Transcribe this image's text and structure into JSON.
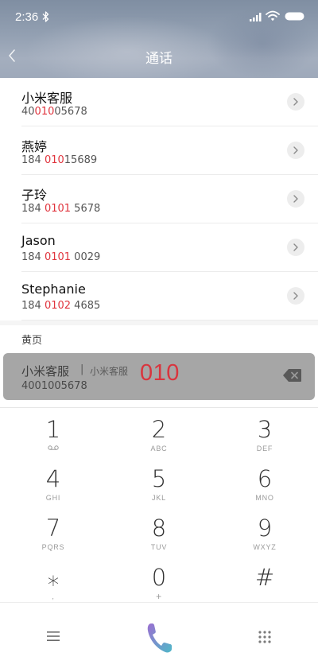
{
  "status_bar": {
    "time": "2:36",
    "icons": [
      "bluetooth-icon",
      "signal-icon",
      "wifi-icon",
      "battery-icon"
    ]
  },
  "header": {
    "title": "通话",
    "back_icon": "chevron-left-icon"
  },
  "contacts": [
    {
      "name": "小米客服",
      "number_pre": "40",
      "number_hl": "010",
      "number_post": "05678"
    },
    {
      "name": "燕婷",
      "number_pre": "184 ",
      "number_hl": "010",
      "number_post": "15689"
    },
    {
      "name": "子玲",
      "number_pre": "184 ",
      "number_hl": "0101",
      "number_post": " 5678"
    },
    {
      "name": "Jason",
      "number_pre": "184 ",
      "number_hl": "0101",
      "number_post": " 0029"
    },
    {
      "name": "Stephanie",
      "number_pre": "184 ",
      "number_hl": "0102",
      "number_post": " 4685"
    }
  ],
  "yellow_pages": {
    "section_label": "黄页",
    "result": {
      "name": "小米客服",
      "separator": "|",
      "tag": "小米客服",
      "number": "4001005678"
    }
  },
  "dial_input": "010",
  "keypad": {
    "keys": [
      {
        "digit": "1",
        "letters": "",
        "sub_icon": "voicemail-icon"
      },
      {
        "digit": "2",
        "letters": "ABC"
      },
      {
        "digit": "3",
        "letters": "DEF"
      },
      {
        "digit": "4",
        "letters": "GHI"
      },
      {
        "digit": "5",
        "letters": "JKL"
      },
      {
        "digit": "6",
        "letters": "MNO"
      },
      {
        "digit": "7",
        "letters": "PQRS"
      },
      {
        "digit": "8",
        "letters": "TUV"
      },
      {
        "digit": "9",
        "letters": "WXYZ"
      },
      {
        "digit": "⁎",
        "letters": ","
      },
      {
        "digit": "0",
        "letters": "+"
      },
      {
        "digit": "#",
        "letters": ""
      }
    ]
  },
  "bottom_bar": {
    "menu_icon": "menu-icon",
    "call_icon": "phone-call-icon",
    "dialpad_icon": "dialpad-grid-icon"
  },
  "colors": {
    "highlight": "#e0343d",
    "dial_text": "#d9353e",
    "call_gradient_start": "#9b6fd1",
    "call_gradient_end": "#4fb8c8"
  }
}
